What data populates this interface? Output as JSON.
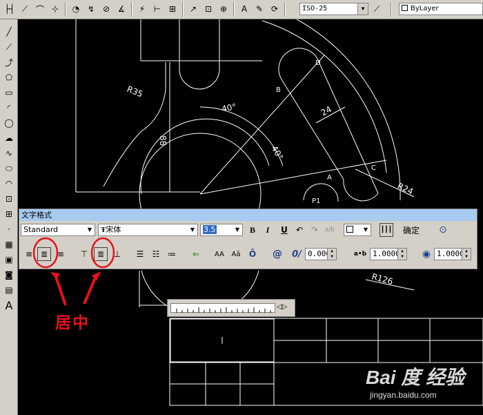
{
  "toolbar": {
    "dimstyle_value": "ISO-25",
    "layer_value": "ByLayer"
  },
  "dialog": {
    "title": "文字格式",
    "style_value": "Standard",
    "font_value": "宋体",
    "height_value": "3.5",
    "bold_label": "B",
    "italic_label": "I",
    "underline_label": "U",
    "stack_label": "a/b",
    "ok_label": "确定",
    "oblique_value": "0.0000",
    "tracking_value": "1.0000",
    "width_value": "1.0000",
    "tracking_icon_label": "a•b",
    "oblique_icon_label": "0/",
    "symbol_label": "@",
    "align_left_label": "≡",
    "uppercase_label": "AA",
    "lowercase_label": "Aā"
  },
  "drawing": {
    "dim_r35": "R35",
    "dim_88": "88",
    "dim_40a": "40°",
    "dim_40b": "40°",
    "dim_24": "24",
    "dim_r24": "R24",
    "dim_r126": "R126",
    "label_a": "A",
    "label_b": "B",
    "label_c": "C",
    "label_d": "D",
    "label_p": "P1"
  },
  "annotation": {
    "text": "居中"
  },
  "watermark": {
    "logo": "Bai 度 经验",
    "url": "jingyan.baidu.com"
  },
  "colors": {
    "annotation_red": "#e8101a",
    "toolbar_gray": "#d4d0c8",
    "title_blue": "#a6caf0",
    "canvas_black": "#000000"
  }
}
